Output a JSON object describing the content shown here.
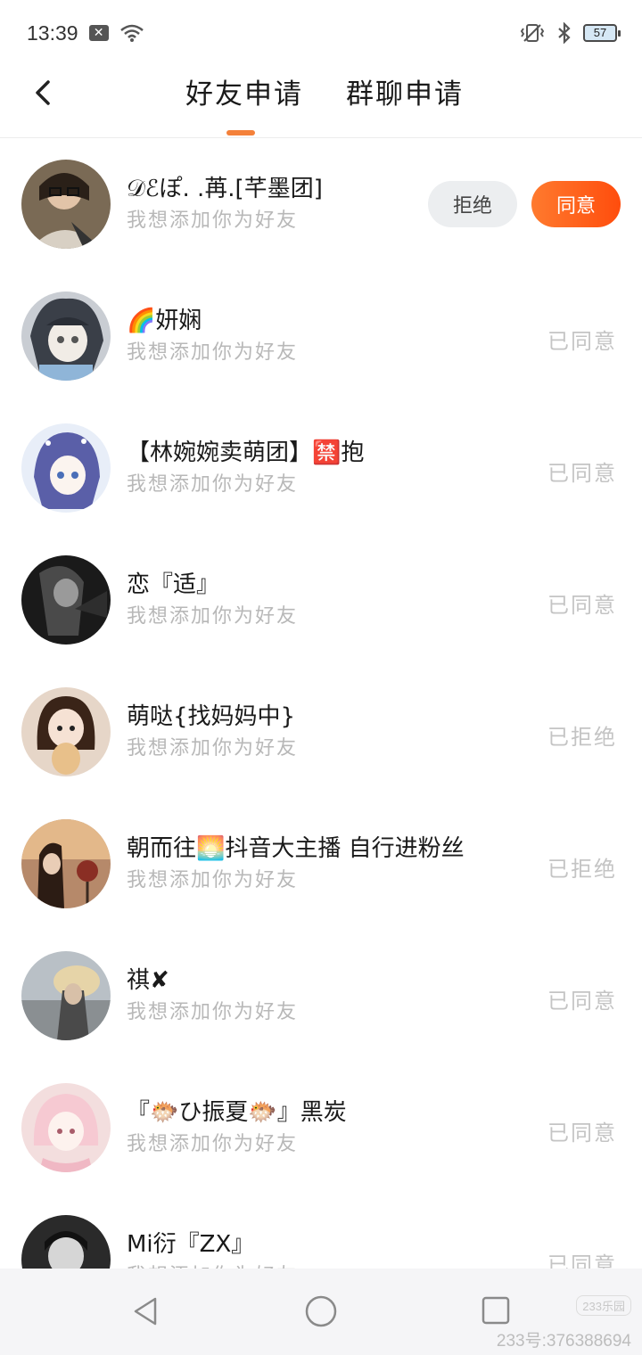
{
  "status_bar": {
    "time": "13:39",
    "notification_icon": "x-icon",
    "wifi_icon": "wifi-icon",
    "vibrate_icon": "vibrate-icon",
    "bluetooth_icon": "bluetooth-icon",
    "battery": "57"
  },
  "header": {
    "back_icon": "chevron-left-icon",
    "tabs": [
      {
        "label": "好友申请",
        "active": true
      },
      {
        "label": "群聊申请",
        "active": false
      }
    ],
    "accent_color": "#f4813a"
  },
  "requests": [
    {
      "nickname": "𝒟ℰぽ.  .苒.[芊墨团]",
      "message": "我想添加你为好友",
      "status": "pending",
      "reject_label": "拒绝",
      "accept_label": "同意"
    },
    {
      "nickname": "🌈妍娴",
      "message": "我想添加你为好友",
      "status": "已同意"
    },
    {
      "nickname": "【林婉婉卖萌团】🈲抱",
      "message": "我想添加你为好友",
      "status": "已同意"
    },
    {
      "nickname": "恋『适』",
      "message": "我想添加你为好友",
      "status": "已同意"
    },
    {
      "nickname": "萌哒{找妈妈中}",
      "message": "我想添加你为好友",
      "status": "已拒绝"
    },
    {
      "nickname": "朝而往🌅抖音大主播 自行进粉丝",
      "message": "我想添加你为好友",
      "status": "已拒绝"
    },
    {
      "nickname": "祺✘",
      "message": "我想添加你为好友",
      "status": "已同意"
    },
    {
      "nickname": "『🐡ひ振夏🐡』黑炭",
      "message": "我想添加你为好友",
      "status": "已同意"
    },
    {
      "nickname": "Mi衍『ZX』",
      "message": "我想添加你为好友",
      "status": "已同意"
    }
  ],
  "nav_bar": {
    "back_icon": "triangle-back-icon",
    "home_icon": "circle-home-icon",
    "recent_icon": "square-recent-icon",
    "watermark": "233乐园",
    "watermark_id": "233号:376388694"
  },
  "colors": {
    "accept_gradient_start": "#ff7a2e",
    "accept_gradient_end": "#ff4d0d",
    "reject_bg": "#eceef0",
    "status_text": "#c4c4c4",
    "message_text": "#b8b8b8"
  }
}
